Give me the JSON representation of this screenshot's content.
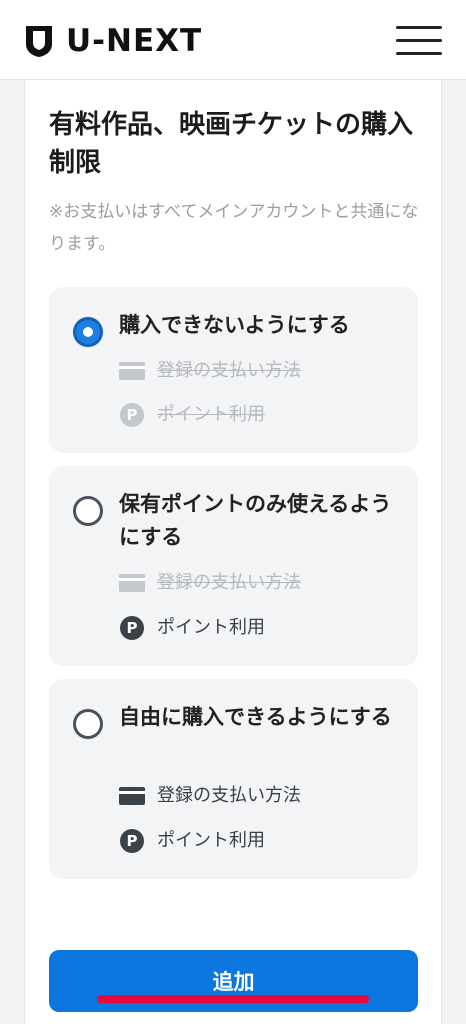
{
  "header": {
    "logo_text": "U-NEXT"
  },
  "section": {
    "title": "有料作品、映画チケットの購入制限",
    "note": "※お支払いはすべてメインアカウントと共通になります。"
  },
  "options": [
    {
      "label": "購入できないようにする",
      "selected": true,
      "features": [
        {
          "icon": "credit-card-icon",
          "text": "登録の支払い方法",
          "enabled": false
        },
        {
          "icon": "point-icon",
          "glyph": "P",
          "text": "ポイント利用",
          "enabled": false
        }
      ]
    },
    {
      "label": "保有ポイントのみ使えるようにする",
      "selected": false,
      "features": [
        {
          "icon": "credit-card-icon",
          "text": "登録の支払い方法",
          "enabled": false
        },
        {
          "icon": "point-icon",
          "glyph": "P",
          "text": "ポイント利用",
          "enabled": true
        }
      ]
    },
    {
      "label": "自由に購入できるようにする",
      "selected": false,
      "features": [
        {
          "icon": "credit-card-icon",
          "text": "登録の支払い方法",
          "enabled": true
        },
        {
          "icon": "point-icon",
          "glyph": "P",
          "text": "ポイント利用",
          "enabled": true
        }
      ]
    }
  ],
  "actions": {
    "add_label": "追加"
  },
  "colors": {
    "primary": "#0b76de",
    "radio_selected": "#1e7fe0",
    "annotation_mark": "#e8093a",
    "disabled_text": "#b6b9bd"
  }
}
